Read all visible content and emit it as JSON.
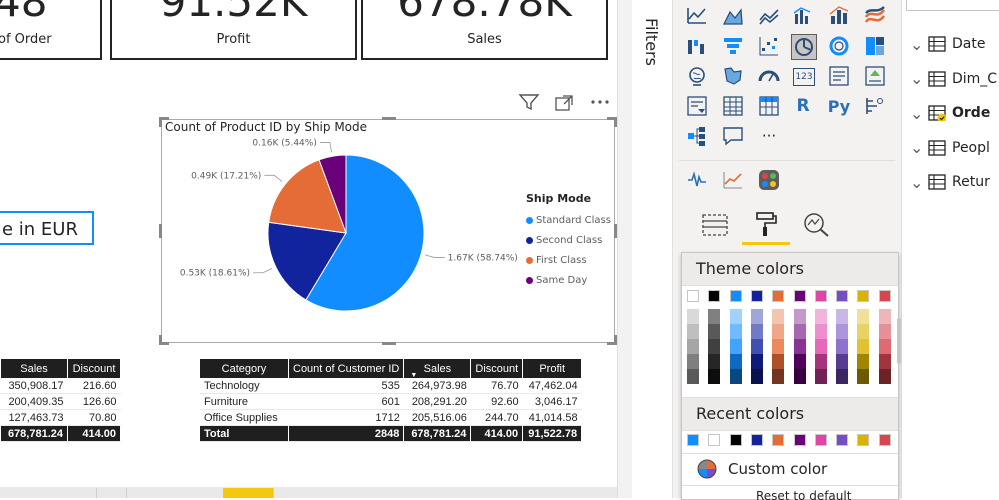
{
  "kpis": [
    {
      "value": "48",
      "label": "of Order"
    },
    {
      "value": "91.52K",
      "label": "Profit"
    },
    {
      "value": "678.78K",
      "label": "Sales"
    }
  ],
  "slicer": {
    "text": "e in  EUR"
  },
  "pie_visual": {
    "title": "Count of Product ID by Ship Mode",
    "legend_title": "Ship Mode"
  },
  "chart_data": {
    "type": "pie",
    "title": "Count of Product ID by Ship Mode",
    "legend_title": "Ship Mode",
    "legend_position": "right",
    "categories": [
      "Standard Class",
      "Second Class",
      "First Class",
      "Same Day"
    ],
    "values": [
      1670,
      530,
      490,
      160
    ],
    "percent": [
      58.74,
      18.61,
      17.21,
      5.44
    ],
    "labels": [
      "1.67K (58.74%)",
      "0.53K (18.61%)",
      "0.49K (17.21%)",
      "0.16K (5.44%)"
    ],
    "colors": [
      "#118DFF",
      "#12239E",
      "#E66C37",
      "#6B007B"
    ]
  },
  "table_left": {
    "columns": [
      "Sales",
      "Discount"
    ],
    "rows": [
      [
        "350,908.17",
        "216.60"
      ],
      [
        "200,409.35",
        "126.60"
      ],
      [
        "127,463.73",
        "70.80"
      ]
    ],
    "total": [
      "678,781.24",
      "414.00"
    ]
  },
  "table_main": {
    "columns": [
      "Category",
      "Count of Customer ID",
      "Sales",
      "Discount",
      "Profit"
    ],
    "rows": [
      [
        "Technology",
        "535",
        "264,973.98",
        "76.70",
        "47,462.04"
      ],
      [
        "Furniture",
        "601",
        "208,291.20",
        "92.60",
        "3,046.17"
      ],
      [
        "Office Supplies",
        "1712",
        "205,516.06",
        "244.70",
        "41,014.58"
      ]
    ],
    "total": [
      "Total",
      "2848",
      "678,781.24",
      "414.00",
      "91,522.78"
    ]
  },
  "filters_pane": {
    "label": "Filters"
  },
  "format_panel": {
    "theme_colors_label": "Theme colors",
    "recent_colors_label": "Recent colors",
    "custom_color_label": "Custom color",
    "reset_label": "Reset to default",
    "theme_colors": [
      "#FFFFFF",
      "#000000",
      "#118DFF",
      "#12239E",
      "#E66C37",
      "#6B007B",
      "#E044A7",
      "#744EC2",
      "#D9B300",
      "#D64550"
    ],
    "recent_colors": [
      "#118DFF",
      "#FFFFFF",
      "#000000",
      "#12239E",
      "#E66C37",
      "#6B007B",
      "#E044A7",
      "#744EC2",
      "#D9B300",
      "#D64550"
    ]
  },
  "viz_icons": {
    "r_label": "R",
    "py_label": "Py",
    "card_label": "123",
    "more_label": "···"
  },
  "fields": [
    {
      "name": "Date",
      "checked": false
    },
    {
      "name": "Dim_C",
      "checked": false
    },
    {
      "name": "Orde",
      "checked": true
    },
    {
      "name": "Peopl",
      "checked": false
    },
    {
      "name": "Retur",
      "checked": false
    }
  ]
}
